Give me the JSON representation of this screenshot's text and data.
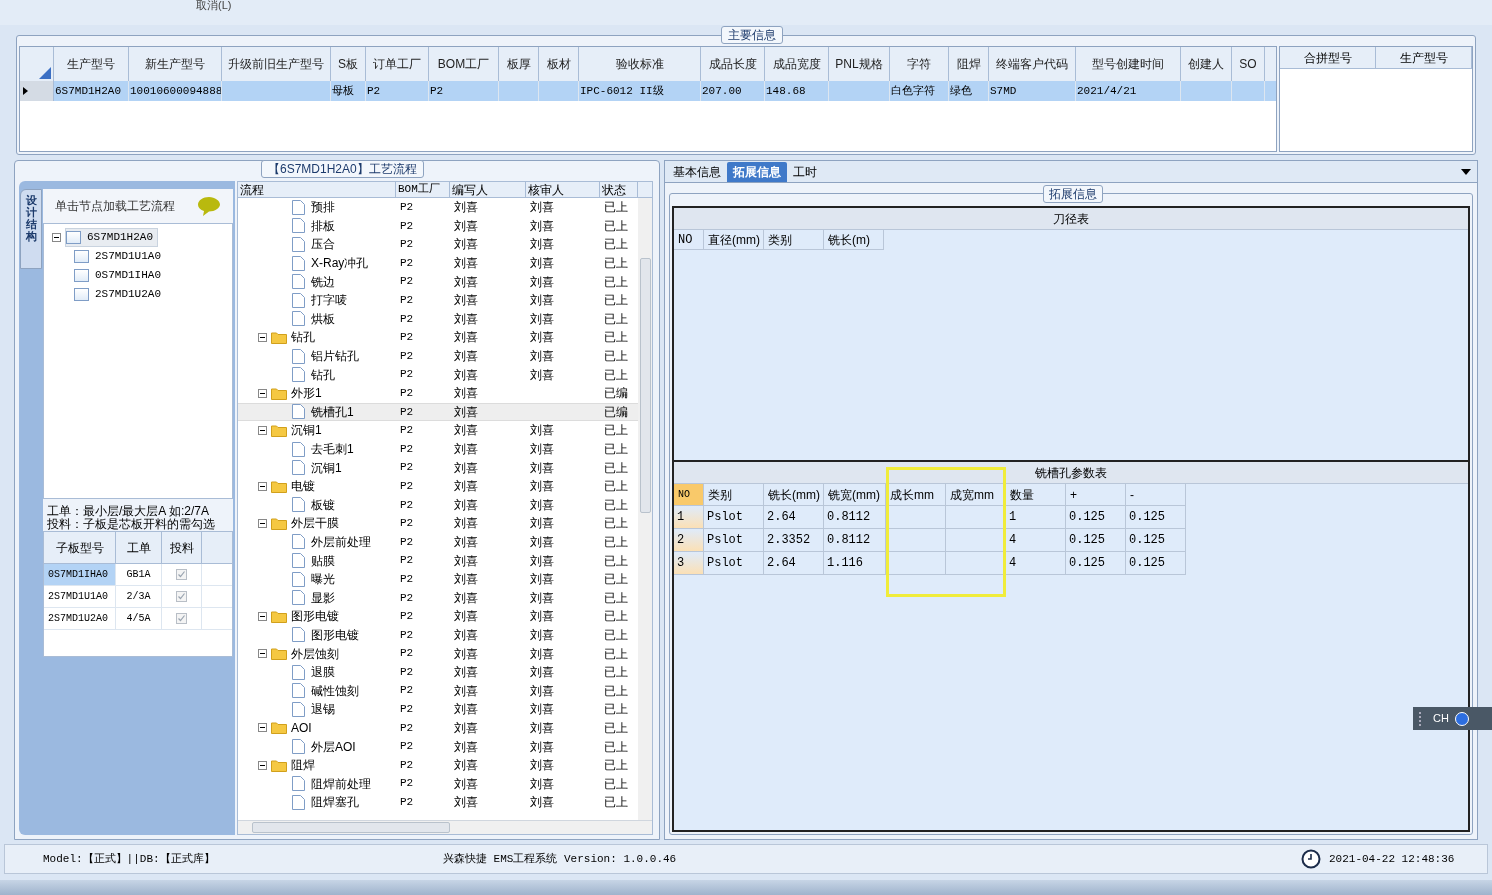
{
  "top_bar": {
    "cancel_label": "取消(L)"
  },
  "main_info": {
    "title": "主要信息",
    "columns": [
      "生产型号",
      "新生产型号",
      "升级前旧生产型号",
      "S板",
      "订单工厂",
      "BOM工厂",
      "板厚",
      "板材",
      "验收标准",
      "成品长度",
      "成品宽度",
      "PNL规格",
      "字符",
      "阻焊",
      "终端客户代码",
      "型号创建时间",
      "创建人",
      "SO"
    ],
    "rows": [
      {
        "selected": true,
        "cells": [
          "6S7MD1H2A0",
          "10010600094888",
          "",
          "母板",
          "P2",
          "P2",
          "",
          "",
          "IPC-6012 II级",
          "207.00",
          "148.68",
          "",
          "白色字符",
          "绿色",
          "S7MD",
          "2021/4/21",
          "",
          ""
        ]
      }
    ],
    "merge_columns": [
      "合拼型号",
      "生产型号"
    ]
  },
  "process": {
    "title": "【6S7MD1H2A0】工艺流程",
    "side_tab": "设计结构",
    "hint": "单击节点加载工艺流程",
    "structure_tree": [
      {
        "label": "6S7MD1H2A0",
        "expanded": true,
        "selected": true,
        "children": [
          {
            "label": "2S7MD1U1A0",
            "selected": false
          },
          {
            "label": "0S7MD1IHA0",
            "selected": false
          },
          {
            "label": "2S7MD1U2A0",
            "selected": false
          }
        ]
      }
    ],
    "notes": [
      "工单：最小层/最大层A 如:2/7A",
      "投料：子板是芯板开料的需勾选"
    ],
    "sub_columns": [
      "子板型号",
      "工单",
      "投料"
    ],
    "sub_rows": [
      {
        "model": "0S7MD1IHA0",
        "order": "GB1A",
        "checked": true,
        "selected": true
      },
      {
        "model": "2S7MD1U1A0",
        "order": "2/3A",
        "checked": true,
        "selected": false
      },
      {
        "model": "2S7MD1U2A0",
        "order": "4/5A",
        "checked": true,
        "selected": false
      }
    ],
    "flow_columns": [
      "流程",
      "BOM工厂",
      "编写人",
      "核审人",
      "状态"
    ],
    "flow": [
      {
        "kind": "step",
        "label": "预排",
        "bom": "P2",
        "author": "刘喜",
        "reviewer": "刘喜",
        "status": "已上",
        "selected": false
      },
      {
        "kind": "step",
        "label": "排板",
        "bom": "P2",
        "author": "刘喜",
        "reviewer": "刘喜",
        "status": "已上",
        "selected": false
      },
      {
        "kind": "step",
        "label": "压合",
        "bom": "P2",
        "author": "刘喜",
        "reviewer": "刘喜",
        "status": "已上",
        "selected": false
      },
      {
        "kind": "step",
        "label": "X-Ray冲孔",
        "bom": "P2",
        "author": "刘喜",
        "reviewer": "刘喜",
        "status": "已上",
        "selected": false
      },
      {
        "kind": "step",
        "label": "铣边",
        "bom": "P2",
        "author": "刘喜",
        "reviewer": "刘喜",
        "status": "已上",
        "selected": false
      },
      {
        "kind": "step",
        "label": "打字唛",
        "bom": "P2",
        "author": "刘喜",
        "reviewer": "刘喜",
        "status": "已上",
        "selected": false
      },
      {
        "kind": "step",
        "label": "烘板",
        "bom": "P2",
        "author": "刘喜",
        "reviewer": "刘喜",
        "status": "已上",
        "selected": false
      },
      {
        "kind": "folder",
        "label": "钻孔",
        "bom": "P2",
        "author": "刘喜",
        "reviewer": "刘喜",
        "status": "已上",
        "selected": false,
        "expanded": true,
        "children": [
          {
            "kind": "step",
            "label": "铝片钻孔",
            "bom": "P2",
            "author": "刘喜",
            "reviewer": "刘喜",
            "status": "已上",
            "selected": false
          },
          {
            "kind": "step",
            "label": "钻孔",
            "bom": "P2",
            "author": "刘喜",
            "reviewer": "刘喜",
            "status": "已上",
            "selected": false
          }
        ]
      },
      {
        "kind": "folder",
        "label": "外形1",
        "bom": "P2",
        "author": "刘喜",
        "status": "已编",
        "selected": false,
        "expanded": true,
        "children": [
          {
            "kind": "step",
            "label": "铣槽孔1",
            "bom": "P2",
            "author": "刘喜",
            "status": "已编",
            "selected": true
          }
        ]
      },
      {
        "kind": "folder",
        "label": "沉铜1",
        "bom": "P2",
        "author": "刘喜",
        "reviewer": "刘喜",
        "status": "已上",
        "selected": false,
        "expanded": true,
        "children": [
          {
            "kind": "step",
            "label": "去毛刺1",
            "bom": "P2",
            "author": "刘喜",
            "reviewer": "刘喜",
            "status": "已上",
            "selected": false
          },
          {
            "kind": "step",
            "label": "沉铜1",
            "bom": "P2",
            "author": "刘喜",
            "reviewer": "刘喜",
            "status": "已上",
            "selected": false
          }
        ]
      },
      {
        "kind": "folder",
        "label": "电镀",
        "bom": "P2",
        "author": "刘喜",
        "reviewer": "刘喜",
        "status": "已上",
        "selected": false,
        "expanded": true,
        "children": [
          {
            "kind": "step",
            "label": "板镀",
            "bom": "P2",
            "author": "刘喜",
            "reviewer": "刘喜",
            "status": "已上",
            "selected": false
          }
        ]
      },
      {
        "kind": "folder",
        "label": "外层干膜",
        "bom": "P2",
        "author": "刘喜",
        "reviewer": "刘喜",
        "status": "已上",
        "selected": false,
        "expanded": true,
        "children": [
          {
            "kind": "step",
            "label": "外层前处理",
            "bom": "P2",
            "author": "刘喜",
            "reviewer": "刘喜",
            "status": "已上",
            "selected": false
          },
          {
            "kind": "step",
            "label": "贴膜",
            "bom": "P2",
            "author": "刘喜",
            "reviewer": "刘喜",
            "status": "已上",
            "selected": false
          },
          {
            "kind": "step",
            "label": "曝光",
            "bom": "P2",
            "author": "刘喜",
            "reviewer": "刘喜",
            "status": "已上",
            "selected": false
          },
          {
            "kind": "step",
            "label": "显影",
            "bom": "P2",
            "author": "刘喜",
            "reviewer": "刘喜",
            "status": "已上",
            "selected": false
          }
        ]
      },
      {
        "kind": "folder",
        "label": "图形电镀",
        "bom": "P2",
        "author": "刘喜",
        "reviewer": "刘喜",
        "status": "已上",
        "selected": false,
        "expanded": true,
        "children": [
          {
            "kind": "step",
            "label": "图形电镀",
            "bom": "P2",
            "author": "刘喜",
            "reviewer": "刘喜",
            "status": "已上",
            "selected": false
          }
        ]
      },
      {
        "kind": "folder",
        "label": "外层蚀刻",
        "bom": "P2",
        "author": "刘喜",
        "reviewer": "刘喜",
        "status": "已上",
        "selected": false,
        "expanded": true,
        "children": [
          {
            "kind": "step",
            "label": "退膜",
            "bom": "P2",
            "author": "刘喜",
            "reviewer": "刘喜",
            "status": "已上",
            "selected": false
          },
          {
            "kind": "step",
            "label": "碱性蚀刻",
            "bom": "P2",
            "author": "刘喜",
            "reviewer": "刘喜",
            "status": "已上",
            "selected": false
          },
          {
            "kind": "step",
            "label": "退锡",
            "bom": "P2",
            "author": "刘喜",
            "reviewer": "刘喜",
            "status": "已上",
            "selected": false
          }
        ]
      },
      {
        "kind": "folder",
        "label": "AOI",
        "bom": "P2",
        "author": "刘喜",
        "reviewer": "刘喜",
        "status": "已上",
        "selected": false,
        "expanded": true,
        "children": [
          {
            "kind": "step",
            "label": "外层AOI",
            "bom": "P2",
            "author": "刘喜",
            "reviewer": "刘喜",
            "status": "已上",
            "selected": false
          }
        ]
      },
      {
        "kind": "folder",
        "label": "阻焊",
        "bom": "P2",
        "author": "刘喜",
        "reviewer": "刘喜",
        "status": "已上",
        "selected": false,
        "expanded": true,
        "children": [
          {
            "kind": "step",
            "label": "阻焊前处理",
            "bom": "P2",
            "author": "刘喜",
            "reviewer": "刘喜",
            "status": "已上",
            "selected": false
          },
          {
            "kind": "step",
            "label": "阻焊塞孔",
            "bom": "P2",
            "author": "刘喜",
            "reviewer": "刘喜",
            "status": "已上",
            "selected": false
          }
        ]
      }
    ]
  },
  "detail": {
    "tabs": [
      {
        "label": "基本信息",
        "selected": false
      },
      {
        "label": "拓展信息",
        "selected": true
      },
      {
        "label": "工时",
        "selected": false
      }
    ],
    "group_title": "拓展信息",
    "cutter_table": {
      "title": "刀径表",
      "columns": [
        "NO",
        "直径(mm)",
        "类别",
        "铣长(m)"
      ]
    },
    "slot_table": {
      "title": "铣槽孔参数表",
      "columns": [
        "NO",
        "类别",
        "铣长(mm)",
        "铣宽(mm)",
        "成长mm",
        "成宽mm",
        "数量",
        "+",
        "-"
      ],
      "rows": [
        [
          "1",
          "Pslot",
          "2.64",
          "0.8112",
          "",
          "",
          "1",
          "0.125",
          "0.125"
        ],
        [
          "2",
          "Pslot",
          "2.3352",
          "0.8112",
          "",
          "",
          "4",
          "0.125",
          "0.125"
        ],
        [
          "3",
          "Pslot",
          "2.64",
          "1.116",
          "",
          "",
          "4",
          "0.125",
          "0.125"
        ]
      ]
    }
  },
  "ime": {
    "label": "CH"
  },
  "status_bar": {
    "mode": "Model:【正式】||DB:【正式库】",
    "app": "兴森快捷 EMS工程系统 Version: 1.0.0.46",
    "time": "2021-04-22 12:48:36"
  }
}
